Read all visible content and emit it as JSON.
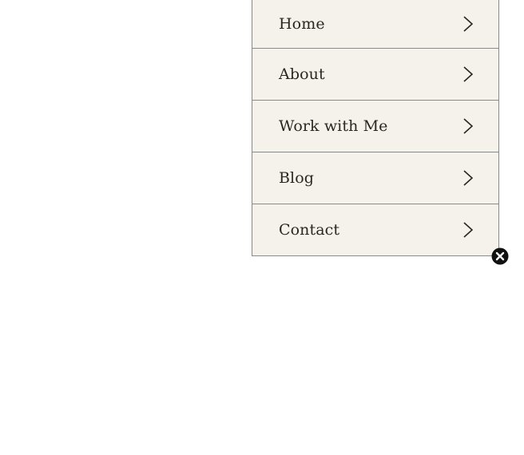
{
  "menu": {
    "items": [
      {
        "label": "Home",
        "icon": "chevron-right-icon"
      },
      {
        "label": "About",
        "icon": "chevron-right-icon"
      },
      {
        "label": "Work with Me",
        "icon": "chevron-right-icon"
      },
      {
        "label": "Blog",
        "icon": "chevron-right-icon"
      },
      {
        "label": "Contact",
        "icon": "chevron-right-icon"
      }
    ],
    "close_icon": "close-icon"
  },
  "colors": {
    "panel_background": "#f5f2ec",
    "divider": "#8a8a8a",
    "text": "#2a2622",
    "close_button": "#111111"
  }
}
